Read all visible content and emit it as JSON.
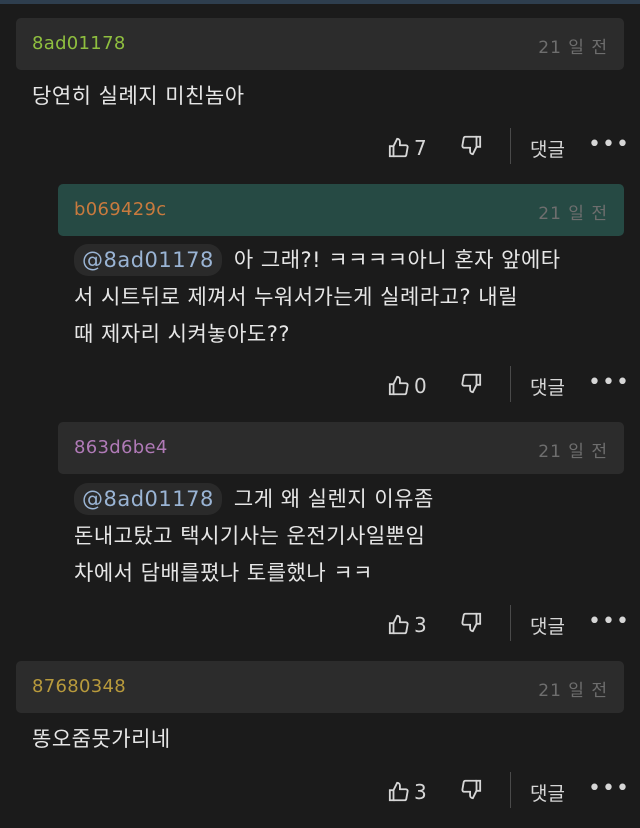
{
  "comments": [
    {
      "author": "8ad01178",
      "author_color": "#8fbf3f",
      "time": "21 일 전",
      "mention": "",
      "lines": [
        "당연히 실례지 미친놈아"
      ],
      "likes": "7",
      "reply_label": "댓글"
    },
    {
      "author": "b069429c",
      "author_color": "#c87a3e",
      "time": "21 일 전",
      "mention": "@8ad01178",
      "lines": [
        "아 그래?! ㅋㅋㅋㅋ아니 혼자 앞에타",
        "서 시트뒤로 제껴서 누워서가는게 실례라고? 내릴",
        "때 제자리 시켜놓아도??"
      ],
      "likes": "0",
      "reply_label": "댓글"
    },
    {
      "author": "863d6be4",
      "author_color": "#b07ab7",
      "time": "21 일 전",
      "mention": "@8ad01178",
      "lines": [
        "그게 왜 실렌지 이유좀",
        "돈내고탔고 택시기사는 운전기사일뿐임",
        "차에서 담배를폈나 토를했나 ㅋㅋ"
      ],
      "likes": "3",
      "reply_label": "댓글"
    },
    {
      "author": "87680348",
      "author_color": "#b89a3c",
      "time": "21 일 전",
      "mention": "",
      "lines": [
        "똥오줌못가리네"
      ],
      "likes": "3",
      "reply_label": "댓글"
    }
  ],
  "icons": {
    "like": "thumbs-up-icon",
    "dislike": "thumbs-down-icon",
    "more": "more-dots-icon"
  },
  "more_label": "•••"
}
